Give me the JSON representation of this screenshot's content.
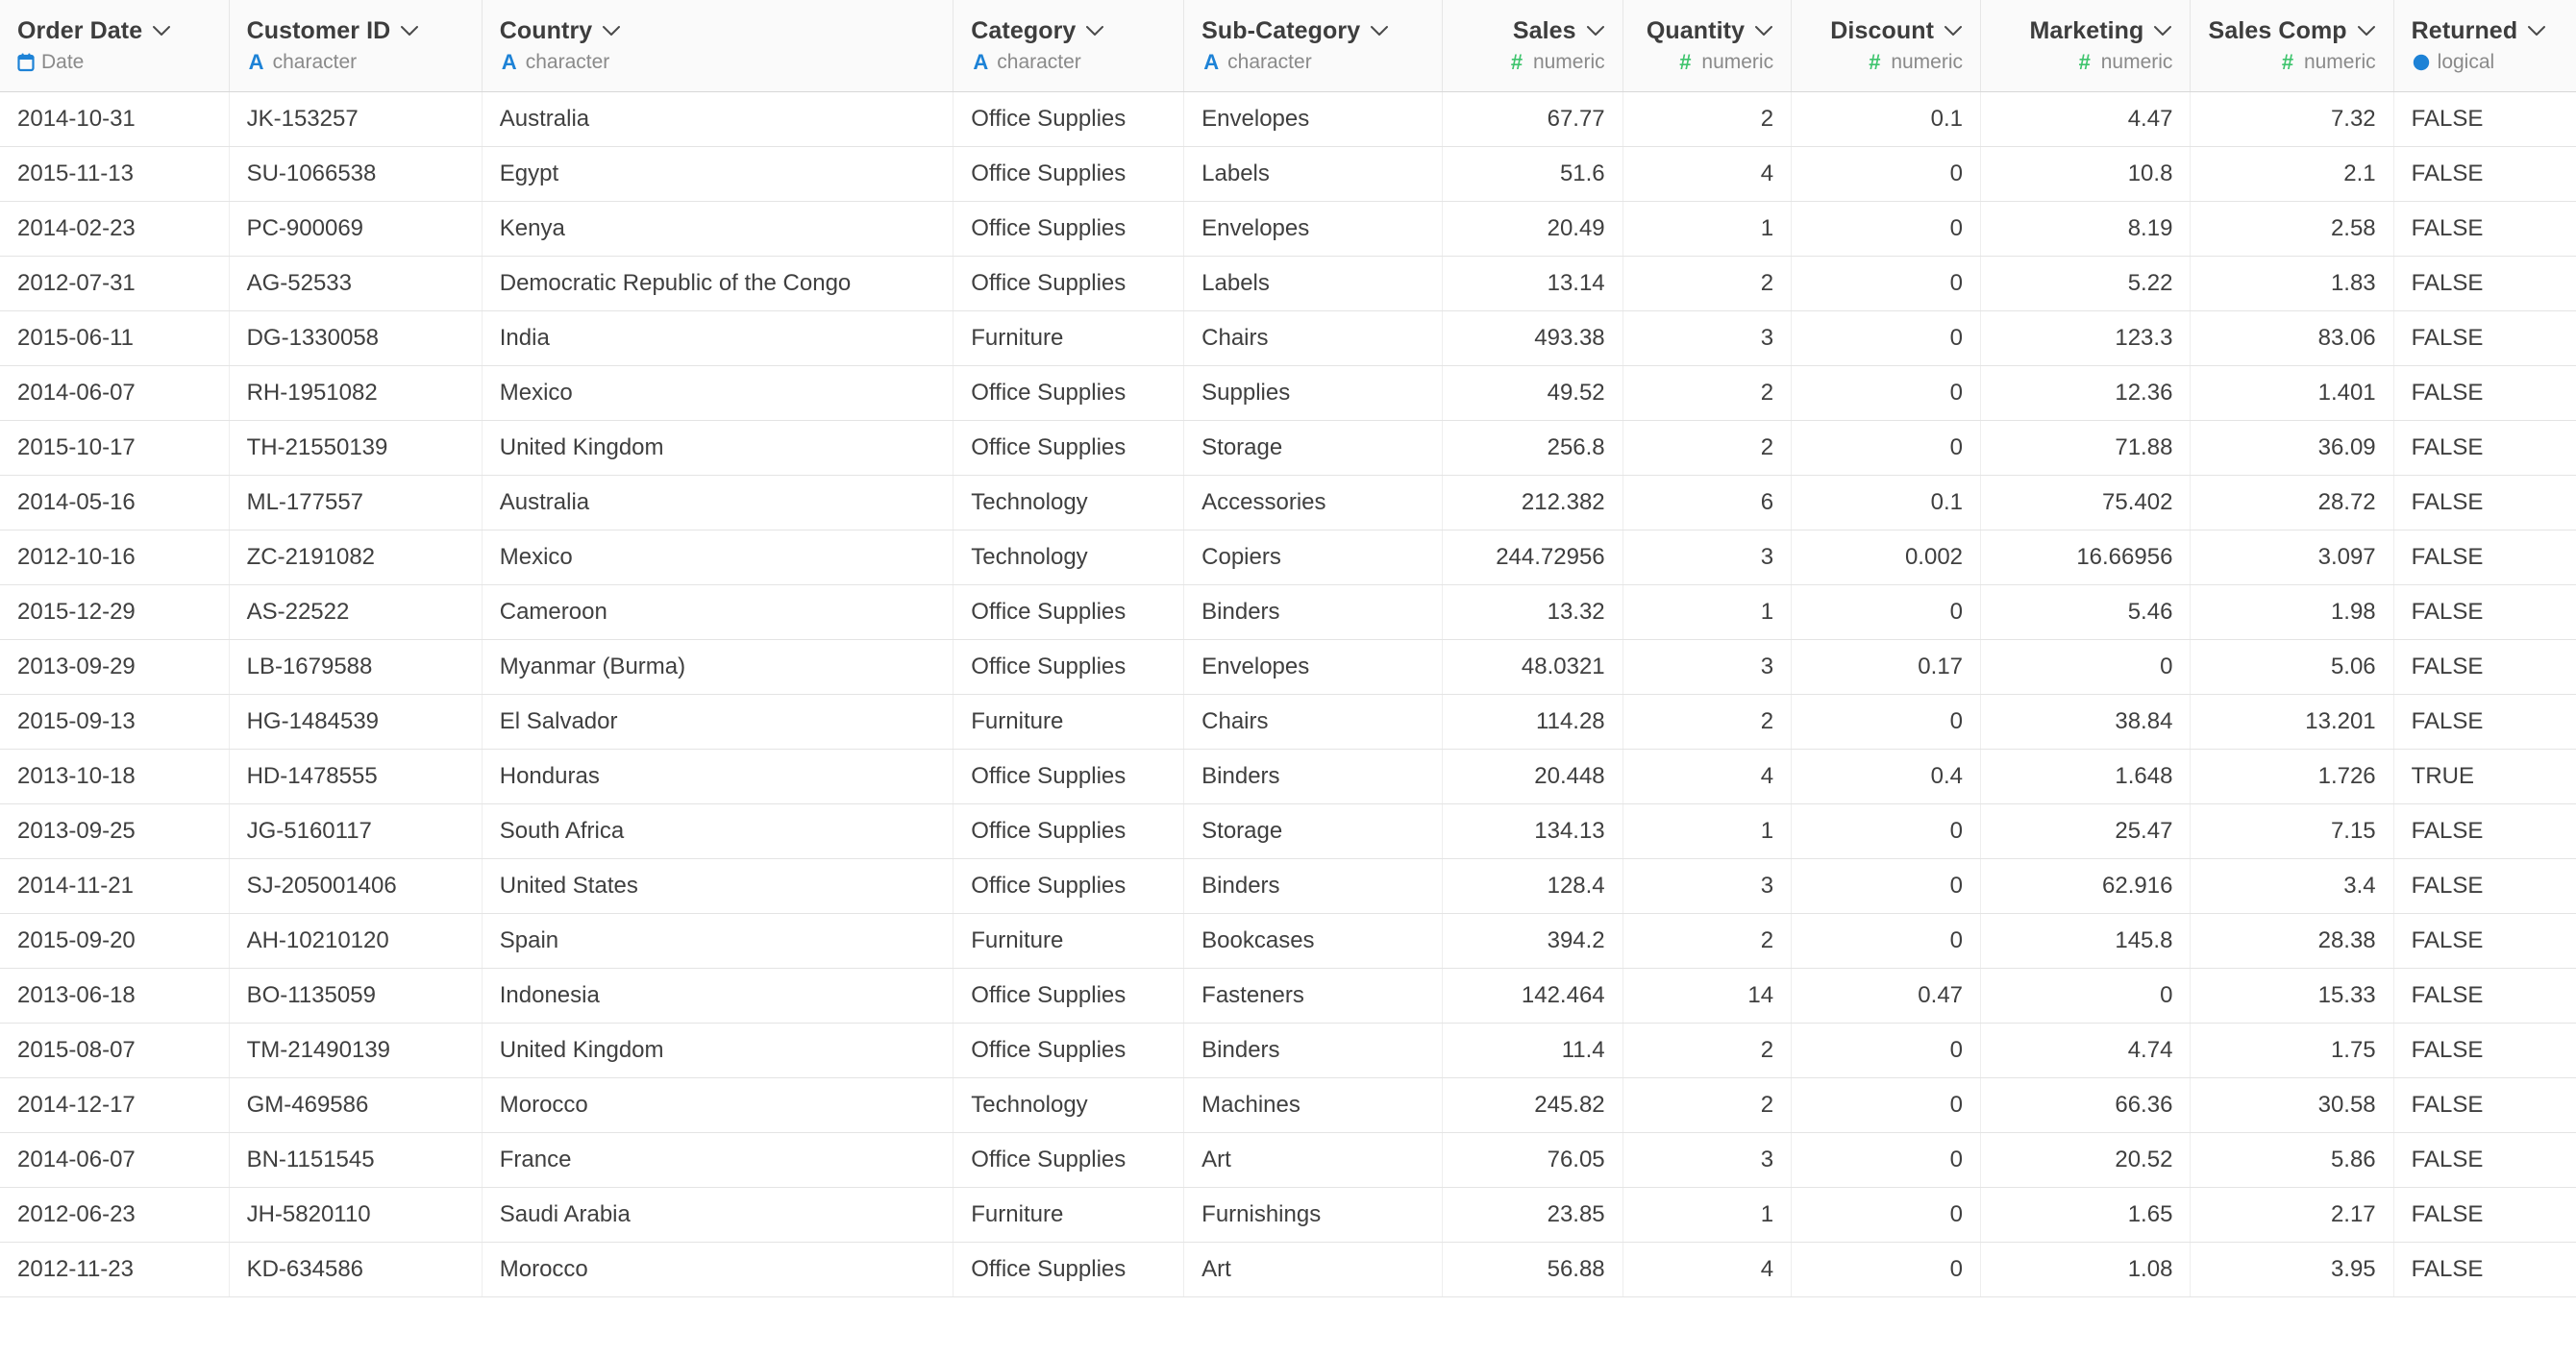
{
  "table": {
    "columns": [
      {
        "name": "Order Date",
        "type_label": "Date",
        "type_icon": "calendar-icon",
        "type_kind": "date",
        "align": "left"
      },
      {
        "name": "Customer ID",
        "type_label": "character",
        "type_icon": "letter-a-icon",
        "type_kind": "char",
        "align": "left"
      },
      {
        "name": "Country",
        "type_label": "character",
        "type_icon": "letter-a-icon",
        "type_kind": "char",
        "align": "left"
      },
      {
        "name": "Category",
        "type_label": "character",
        "type_icon": "letter-a-icon",
        "type_kind": "char",
        "align": "left"
      },
      {
        "name": "Sub-Category",
        "type_label": "character",
        "type_icon": "letter-a-icon",
        "type_kind": "char",
        "align": "left"
      },
      {
        "name": "Sales",
        "type_label": "numeric",
        "type_icon": "hash-icon",
        "type_kind": "num",
        "align": "right"
      },
      {
        "name": "Quantity",
        "type_label": "numeric",
        "type_icon": "hash-icon",
        "type_kind": "num",
        "align": "right"
      },
      {
        "name": "Discount",
        "type_label": "numeric",
        "type_icon": "hash-icon",
        "type_kind": "num",
        "align": "right"
      },
      {
        "name": "Marketing",
        "type_label": "numeric",
        "type_icon": "hash-icon",
        "type_kind": "num",
        "align": "right"
      },
      {
        "name": "Sales Comp",
        "type_label": "numeric",
        "type_icon": "hash-icon",
        "type_kind": "num",
        "align": "right"
      },
      {
        "name": "Returned",
        "type_label": "logical",
        "type_icon": "boolean-icon",
        "type_kind": "logical",
        "align": "left"
      }
    ],
    "sort_menu_icon": "chevron-down-icon",
    "rows": [
      {
        "order_date": "2014-10-31",
        "customer_id": "JK-153257",
        "country": "Australia",
        "category": "Office Supplies",
        "sub_category": "Envelopes",
        "sales": "67.77",
        "quantity": "2",
        "discount": "0.1",
        "marketing": "4.47",
        "sales_comp": "7.32",
        "returned": "FALSE"
      },
      {
        "order_date": "2015-11-13",
        "customer_id": "SU-1066538",
        "country": "Egypt",
        "category": "Office Supplies",
        "sub_category": "Labels",
        "sales": "51.6",
        "quantity": "4",
        "discount": "0",
        "marketing": "10.8",
        "sales_comp": "2.1",
        "returned": "FALSE"
      },
      {
        "order_date": "2014-02-23",
        "customer_id": "PC-900069",
        "country": "Kenya",
        "category": "Office Supplies",
        "sub_category": "Envelopes",
        "sales": "20.49",
        "quantity": "1",
        "discount": "0",
        "marketing": "8.19",
        "sales_comp": "2.58",
        "returned": "FALSE"
      },
      {
        "order_date": "2012-07-31",
        "customer_id": "AG-52533",
        "country": "Democratic Republic of the Congo",
        "category": "Office Supplies",
        "sub_category": "Labels",
        "sales": "13.14",
        "quantity": "2",
        "discount": "0",
        "marketing": "5.22",
        "sales_comp": "1.83",
        "returned": "FALSE"
      },
      {
        "order_date": "2015-06-11",
        "customer_id": "DG-1330058",
        "country": "India",
        "category": "Furniture",
        "sub_category": "Chairs",
        "sales": "493.38",
        "quantity": "3",
        "discount": "0",
        "marketing": "123.3",
        "sales_comp": "83.06",
        "returned": "FALSE"
      },
      {
        "order_date": "2014-06-07",
        "customer_id": "RH-1951082",
        "country": "Mexico",
        "category": "Office Supplies",
        "sub_category": "Supplies",
        "sales": "49.52",
        "quantity": "2",
        "discount": "0",
        "marketing": "12.36",
        "sales_comp": "1.401",
        "returned": "FALSE"
      },
      {
        "order_date": "2015-10-17",
        "customer_id": "TH-21550139",
        "country": "United Kingdom",
        "category": "Office Supplies",
        "sub_category": "Storage",
        "sales": "256.8",
        "quantity": "2",
        "discount": "0",
        "marketing": "71.88",
        "sales_comp": "36.09",
        "returned": "FALSE"
      },
      {
        "order_date": "2014-05-16",
        "customer_id": "ML-177557",
        "country": "Australia",
        "category": "Technology",
        "sub_category": "Accessories",
        "sales": "212.382",
        "quantity": "6",
        "discount": "0.1",
        "marketing": "75.402",
        "sales_comp": "28.72",
        "returned": "FALSE"
      },
      {
        "order_date": "2012-10-16",
        "customer_id": "ZC-2191082",
        "country": "Mexico",
        "category": "Technology",
        "sub_category": "Copiers",
        "sales": "244.72956",
        "quantity": "3",
        "discount": "0.002",
        "marketing": "16.66956",
        "sales_comp": "3.097",
        "returned": "FALSE"
      },
      {
        "order_date": "2015-12-29",
        "customer_id": "AS-22522",
        "country": "Cameroon",
        "category": "Office Supplies",
        "sub_category": "Binders",
        "sales": "13.32",
        "quantity": "1",
        "discount": "0",
        "marketing": "5.46",
        "sales_comp": "1.98",
        "returned": "FALSE"
      },
      {
        "order_date": "2013-09-29",
        "customer_id": "LB-1679588",
        "country": "Myanmar (Burma)",
        "category": "Office Supplies",
        "sub_category": "Envelopes",
        "sales": "48.0321",
        "quantity": "3",
        "discount": "0.17",
        "marketing": "0",
        "sales_comp": "5.06",
        "returned": "FALSE"
      },
      {
        "order_date": "2015-09-13",
        "customer_id": "HG-1484539",
        "country": "El Salvador",
        "category": "Furniture",
        "sub_category": "Chairs",
        "sales": "114.28",
        "quantity": "2",
        "discount": "0",
        "marketing": "38.84",
        "sales_comp": "13.201",
        "returned": "FALSE"
      },
      {
        "order_date": "2013-10-18",
        "customer_id": "HD-1478555",
        "country": "Honduras",
        "category": "Office Supplies",
        "sub_category": "Binders",
        "sales": "20.448",
        "quantity": "4",
        "discount": "0.4",
        "marketing": "1.648",
        "sales_comp": "1.726",
        "returned": "TRUE"
      },
      {
        "order_date": "2013-09-25",
        "customer_id": "JG-5160117",
        "country": "South Africa",
        "category": "Office Supplies",
        "sub_category": "Storage",
        "sales": "134.13",
        "quantity": "1",
        "discount": "0",
        "marketing": "25.47",
        "sales_comp": "7.15",
        "returned": "FALSE"
      },
      {
        "order_date": "2014-11-21",
        "customer_id": "SJ-205001406",
        "country": "United States",
        "category": "Office Supplies",
        "sub_category": "Binders",
        "sales": "128.4",
        "quantity": "3",
        "discount": "0",
        "marketing": "62.916",
        "sales_comp": "3.4",
        "returned": "FALSE"
      },
      {
        "order_date": "2015-09-20",
        "customer_id": "AH-10210120",
        "country": "Spain",
        "category": "Furniture",
        "sub_category": "Bookcases",
        "sales": "394.2",
        "quantity": "2",
        "discount": "0",
        "marketing": "145.8",
        "sales_comp": "28.38",
        "returned": "FALSE"
      },
      {
        "order_date": "2013-06-18",
        "customer_id": "BO-1135059",
        "country": "Indonesia",
        "category": "Office Supplies",
        "sub_category": "Fasteners",
        "sales": "142.464",
        "quantity": "14",
        "discount": "0.47",
        "marketing": "0",
        "sales_comp": "15.33",
        "returned": "FALSE"
      },
      {
        "order_date": "2015-08-07",
        "customer_id": "TM-21490139",
        "country": "United Kingdom",
        "category": "Office Supplies",
        "sub_category": "Binders",
        "sales": "11.4",
        "quantity": "2",
        "discount": "0",
        "marketing": "4.74",
        "sales_comp": "1.75",
        "returned": "FALSE"
      },
      {
        "order_date": "2014-12-17",
        "customer_id": "GM-469586",
        "country": "Morocco",
        "category": "Technology",
        "sub_category": "Machines",
        "sales": "245.82",
        "quantity": "2",
        "discount": "0",
        "marketing": "66.36",
        "sales_comp": "30.58",
        "returned": "FALSE"
      },
      {
        "order_date": "2014-06-07",
        "customer_id": "BN-1151545",
        "country": "France",
        "category": "Office Supplies",
        "sub_category": "Art",
        "sales": "76.05",
        "quantity": "3",
        "discount": "0",
        "marketing": "20.52",
        "sales_comp": "5.86",
        "returned": "FALSE"
      },
      {
        "order_date": "2012-06-23",
        "customer_id": "JH-5820110",
        "country": "Saudi Arabia",
        "category": "Furniture",
        "sub_category": "Furnishings",
        "sales": "23.85",
        "quantity": "1",
        "discount": "0",
        "marketing": "1.65",
        "sales_comp": "2.17",
        "returned": "FALSE"
      },
      {
        "order_date": "2012-11-23",
        "customer_id": "KD-634586",
        "country": "Morocco",
        "category": "Office Supplies",
        "sub_category": "Art",
        "sales": "56.88",
        "quantity": "4",
        "discount": "0",
        "marketing": "1.08",
        "sales_comp": "3.95",
        "returned": "FALSE"
      }
    ]
  },
  "colors": {
    "header_bg": "#fafafa",
    "char_type": "#1d82d6",
    "numeric_type": "#3ec46d",
    "date_type": "#1d82d6",
    "logical_type": "#1d82d6",
    "text": "#3f3f3f",
    "header_text": "#3d3d3d",
    "type_label_text": "#8a8a8a",
    "border": "#e4e4e4"
  }
}
